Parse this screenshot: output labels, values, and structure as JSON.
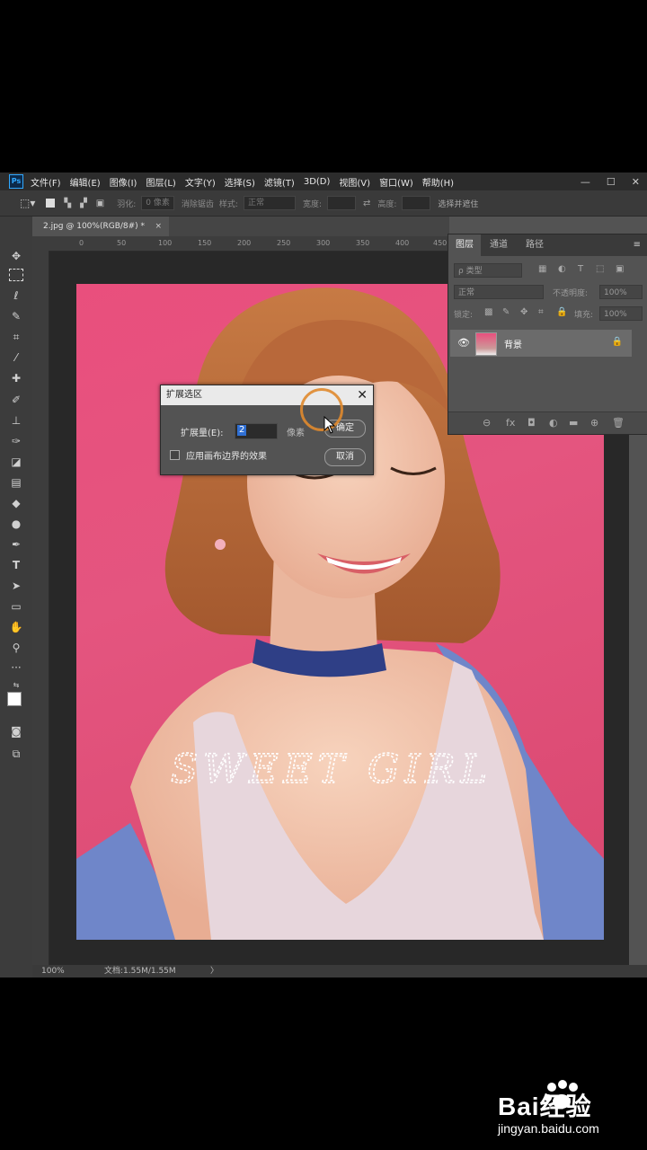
{
  "app": {
    "logo": "Ps",
    "menu": [
      "文件(F)",
      "编辑(E)",
      "图像(I)",
      "图层(L)",
      "文字(Y)",
      "选择(S)",
      "滤镜(T)",
      "3D(D)",
      "视图(V)",
      "窗口(W)",
      "帮助(H)"
    ],
    "window_buttons": [
      "—",
      "☐",
      "✕"
    ]
  },
  "options": {
    "feather_label": "羽化:",
    "feather_value": "0 像素",
    "antialias_label": "消除锯齿",
    "style_label": "样式:",
    "style_value": "正常",
    "width_label": "宽度:",
    "height_label": "高度:",
    "select_mask": "选择并遮住"
  },
  "tab": {
    "title": "2.jpg @ 100%(RGB/8#) *",
    "close": "×"
  },
  "ruler": {
    "h_ticks": [
      "0",
      "50",
      "100",
      "150",
      "200",
      "250",
      "300",
      "350",
      "400",
      "450"
    ]
  },
  "layers_panel": {
    "tabs": [
      "图层",
      "通道",
      "路径"
    ],
    "kind_label": "ρ 类型",
    "blend_mode": "正常",
    "opacity_label": "不透明度:",
    "opacity_value": "100%",
    "lock_label": "锁定:",
    "fill_label": "填充:",
    "fill_value": "100%",
    "layer_name": "背景",
    "bottom_icons": [
      "⊖",
      "fx",
      "◘",
      "◐",
      "▬",
      "⊕",
      "🗑"
    ]
  },
  "dialog": {
    "title": "扩展选区",
    "close": "✕",
    "amount_label": "扩展量(E):",
    "amount_value": "2",
    "unit": "像素",
    "checkbox_label": "应用画布边界的效果",
    "ok_label": "确定",
    "cancel_label": "取消"
  },
  "image": {
    "overlay_text": "SWEET GIRL"
  },
  "status": {
    "zoom": "100%",
    "doc": "文档:1.55M/1.55M",
    "arrow": "〉"
  },
  "watermark": {
    "brand": "Bai经验",
    "url": "jingyan.baidu.com"
  },
  "colors": {
    "wall_pink": "#e94f7d",
    "hair": "#b8683a",
    "skin": "#f2c2a8",
    "shirt": "#6f86c9",
    "tank": "#e7d6dc",
    "dialog_ring": "#e08a2e"
  }
}
